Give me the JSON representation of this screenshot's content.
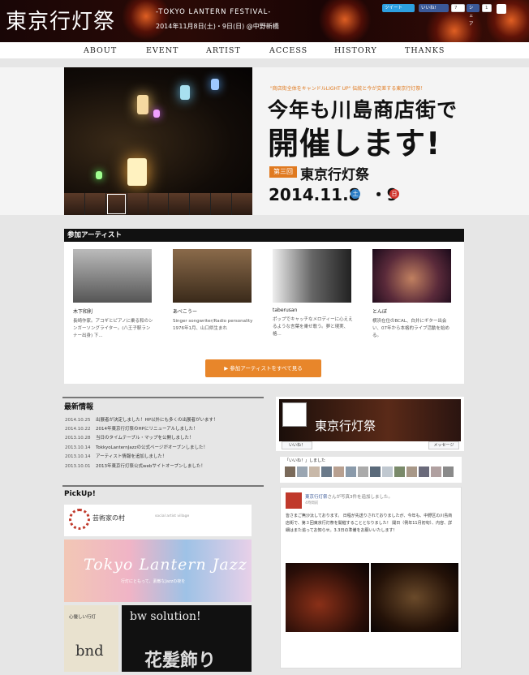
{
  "header": {
    "logo": "東京行灯祭",
    "subtitle": "-TOKYO LANTERN FESTIVAL-",
    "date_location": "2014年11月8日(土)・9日(日) @中野新橋",
    "social": {
      "tweet": "ツイート",
      "like": "いいね!",
      "like_count": "7",
      "share": "シェア",
      "plus_count": "1"
    }
  },
  "nav": [
    {
      "label": "ABOUT"
    },
    {
      "label": "EVENT"
    },
    {
      "label": "ARTIST"
    },
    {
      "label": "ACCESS"
    },
    {
      "label": "HISTORY"
    },
    {
      "label": "THANKS"
    }
  ],
  "hero": {
    "tagline": "\"商店街全体をキャンドルLIGHT UP\" 伝統と今が交差する東京行灯祭！",
    "headline1": "今年も川島商店街で",
    "headline2": "開催します!",
    "edition_badge": "第三回",
    "festival_name": "東京行灯祭",
    "date": "2014.11.8",
    "dot": "・",
    "day2": "9",
    "sat": "土",
    "sun": "日"
  },
  "artists": {
    "heading": "参加アーティスト",
    "cards": [
      {
        "name": "木下和則",
        "desc": "長崎作家。アコギとピアノに乗る和のシンガーソングライター。(八王子駅ランナー出身) 下..."
      },
      {
        "name": "あべこうー",
        "desc": "Singer songwriter/Radio personality 1976年1月、山口県生まれ"
      },
      {
        "name": "taberusan",
        "desc": "ポップでキャッチなメロディーに心ええるような言葉を乗せ歌う。夢と現実、格..."
      },
      {
        "name": "とんぼ",
        "desc": "横浜在住のBCAL、白井にギター出会い、07年から本格的ライブ活動を始める。"
      }
    ],
    "all_button": "▶ 参加アーティストをすべて見る"
  },
  "news": {
    "heading": "最新情報",
    "items": [
      {
        "date": "2014.10.25",
        "text": "出展者が決定しました！HP以外にも多くの出展者がいます！"
      },
      {
        "date": "2014.10.22",
        "text": "2014年東京行灯祭のHPにリニューアルしました！"
      },
      {
        "date": "2013.10.28",
        "text": "当日のタイムテーブル・マップを公開しました！"
      },
      {
        "date": "2013.10.14",
        "text": "TokkyoLanternJazzの公式ページがオープンしました！"
      },
      {
        "date": "2013.10.14",
        "text": "アーティスト情報を追加しました！"
      },
      {
        "date": "2013.10.01",
        "text": "2013年東京行灯祭公式webサイトオープンしました！"
      }
    ]
  },
  "pickup": {
    "heading": "PickUp!",
    "banner1_title": "芸術家の村",
    "banner1_sub": "social artist village",
    "banner2_title": "Tokyo Lantern Jazz",
    "banner2_sub": "行灯にともって、素敵なJazzの夜を",
    "banner3_title": "心優しい行灯",
    "banner3_brand": "bnd",
    "banner4_title": "bw solution!",
    "banner4_brand": "花髪飾り"
  },
  "facebook": {
    "page_name": "東京行灯祭",
    "like_button": "いいね！",
    "message_button": "メッセージ",
    "fans_text": "「いいね！」しました",
    "post_author": "東京行灯祭",
    "post_action": "さんが写真3件を追加しました。",
    "post_time": "4時間前",
    "post_body": "皆さまご無沙汰しております。 日程が先送りされておりましたが、今年も、中野区の川島商店街で、第３回東京行灯祭を開催することとなりました！ 開日（例年11月初旬）、内容、詳細はまた追ってお知らせ。3.3日の準備をお願いいたします！"
  },
  "colors": {
    "accent": "#e8862a",
    "header_bg": "#1c0706",
    "section_head": "#111111",
    "sat": "#2f7fc6",
    "sun": "#d0342c"
  }
}
